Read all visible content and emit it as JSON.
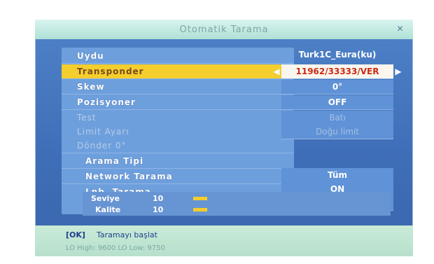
{
  "title": "Otomatik Tarama",
  "close_icon": "close-icon",
  "left_menu": [
    {
      "label": "Uydu",
      "state": "normal",
      "indent": false
    },
    {
      "label": "Transponder",
      "state": "selected",
      "indent": false
    },
    {
      "label": "Skew",
      "state": "normal",
      "indent": false
    },
    {
      "label": "Pozisyoner",
      "state": "normal",
      "indent": false
    },
    {
      "label": "Test",
      "state": "dim",
      "indent": false
    },
    {
      "label": "Limit Ayarı",
      "state": "dim",
      "indent": false
    },
    {
      "label": "Dönder 0°",
      "state": "dim",
      "indent": false
    },
    {
      "label": "Arama Tipi",
      "state": "normal",
      "indent": true
    },
    {
      "label": "Network Tarama",
      "state": "normal",
      "indent": true
    },
    {
      "label": "Lnb. Tarama",
      "state": "normal",
      "indent": true
    }
  ],
  "right_values": {
    "satellite": "Turk1C_Eura(ku)",
    "transponder": "11962/33333/VER",
    "skew": "0°",
    "positioner": "OFF",
    "test": "Batı",
    "limit": "Doğu limit",
    "search_type": "Tüm",
    "network_scan": "ON",
    "lnb_scan": "ON"
  },
  "signals": {
    "level_label": "Seviye",
    "level_value": "10",
    "quality_label": "Kalite",
    "quality_value": "10",
    "level_fill": 0.1,
    "quality_fill": 0.1
  },
  "footer": {
    "ok_key": "[OK]",
    "ok_hint": "Taramayı başlat",
    "lnb_line": "LO High: 9600 LO Low: 9750"
  },
  "colors": {
    "panel": "#6e9fdd",
    "selected": "#f4ce2d",
    "title_bg": "#aee0d6",
    "footer_bg": "#c9ebd8"
  }
}
